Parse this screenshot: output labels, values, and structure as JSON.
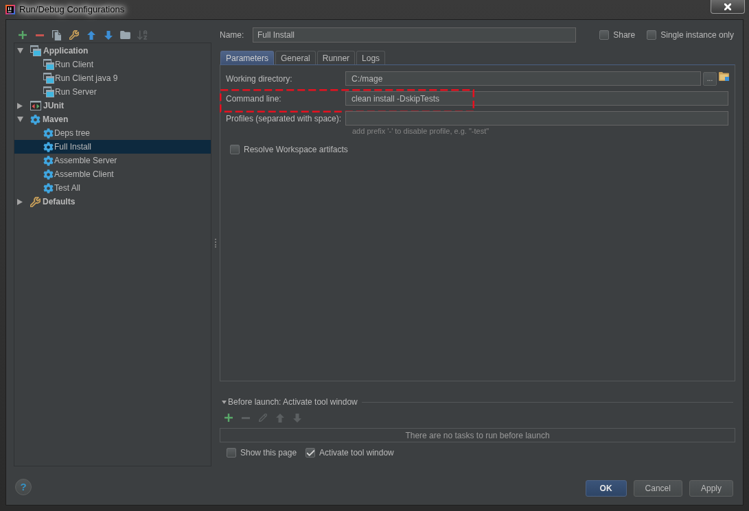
{
  "window": {
    "title": "Run/Debug Configurations"
  },
  "toolbar": [
    {
      "kind": "add",
      "disabled": false
    },
    {
      "kind": "remove",
      "disabled": false
    },
    {
      "kind": "copy",
      "disabled": false
    },
    {
      "kind": "defaults",
      "disabled": false
    },
    {
      "kind": "up",
      "disabled": false
    },
    {
      "kind": "down",
      "disabled": false
    },
    {
      "kind": "folder",
      "disabled": false
    },
    {
      "kind": "sort",
      "disabled": true
    }
  ],
  "tree": [
    {
      "label": "Application",
      "kind": "application",
      "expanded": true,
      "selected": false,
      "children": [
        {
          "label": "Run Client",
          "kind": "application",
          "selected": false
        },
        {
          "label": "Run Client java 9",
          "kind": "application",
          "selected": false
        },
        {
          "label": "Run Server",
          "kind": "application",
          "selected": false
        }
      ]
    },
    {
      "label": "JUnit",
      "kind": "junit",
      "expanded": false,
      "selected": false
    },
    {
      "label": "Maven",
      "kind": "maven",
      "expanded": true,
      "selected": false,
      "children": [
        {
          "label": "Deps tree",
          "kind": "maven",
          "selected": false
        },
        {
          "label": "Full Install",
          "kind": "maven",
          "selected": true
        },
        {
          "label": "Assemble Server",
          "kind": "maven",
          "selected": false
        },
        {
          "label": "Assemble Client",
          "kind": "maven",
          "selected": false
        },
        {
          "label": "Test All",
          "kind": "maven",
          "selected": false
        }
      ]
    },
    {
      "label": "Defaults",
      "kind": "defaults",
      "expanded": false,
      "selected": false
    }
  ],
  "name_field": {
    "label": "Name:",
    "value": "Full Install"
  },
  "options": [
    {
      "label": "Share",
      "checked": false
    },
    {
      "label": "Single instance only",
      "checked": false
    }
  ],
  "tabs": [
    {
      "label": "Parameters",
      "selected": true
    },
    {
      "label": "General",
      "selected": false
    },
    {
      "label": "Runner",
      "selected": false
    },
    {
      "label": "Logs",
      "selected": false
    }
  ],
  "fields": [
    {
      "kind": "browse",
      "label": "Working directory:",
      "value": "C:/mage",
      "button": "...",
      "highlighted": false
    },
    {
      "kind": "text",
      "label": "Command line:",
      "value": "clean install -DskipTests",
      "highlighted": true
    },
    {
      "kind": "text",
      "label": "Profiles (separated with space):",
      "helper": "add prefix '-' to disable profile, e.g. \"-test\"",
      "highlighted": false
    }
  ],
  "resolve_workspace": {
    "label": "Resolve Workspace artifacts",
    "checked": false
  },
  "before_launch": {
    "title": "Before launch: Activate tool window",
    "expanded": true,
    "toolbar": [
      {
        "kind": "add",
        "disabled": false
      },
      {
        "kind": "remove",
        "disabled": true
      },
      {
        "kind": "edit",
        "disabled": true
      },
      {
        "kind": "up",
        "disabled": true
      },
      {
        "kind": "down",
        "disabled": true
      }
    ],
    "empty_text": "There are no tasks to run before launch",
    "options": [
      {
        "label": "Show this page",
        "checked": false
      },
      {
        "label": "Activate tool window",
        "checked": true
      }
    ]
  },
  "help_button": {
    "label": "?"
  },
  "buttons": [
    {
      "label": "OK",
      "kind": "default"
    },
    {
      "label": "Cancel",
      "kind": "normal"
    },
    {
      "label": "Apply",
      "kind": "normal"
    }
  ]
}
